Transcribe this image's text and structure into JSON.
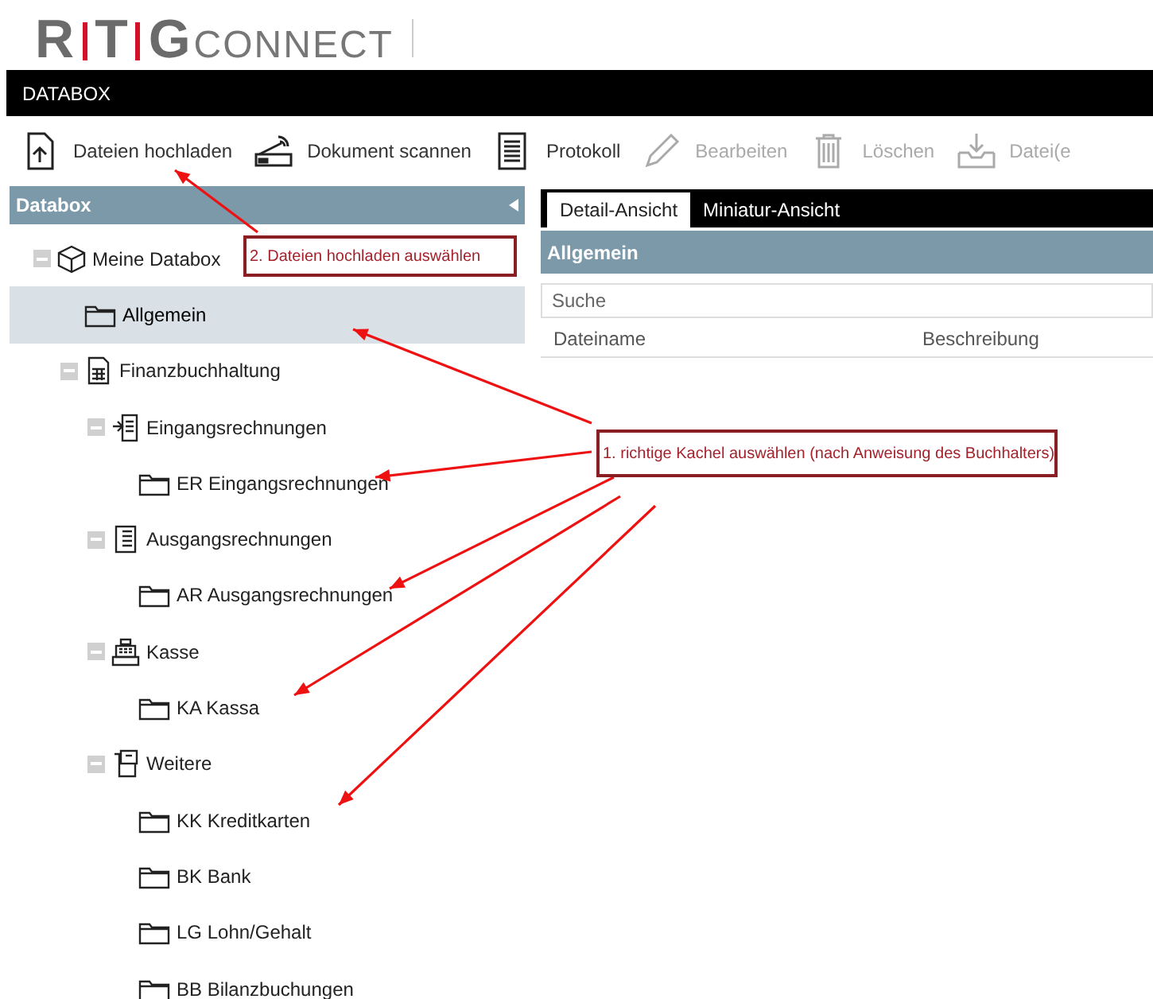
{
  "logo": {
    "letters": [
      "R",
      "T",
      "G"
    ],
    "suffix": "CONNECT"
  },
  "app_bar": {
    "title": "DATABOX"
  },
  "toolbar": [
    {
      "label": "Dateien hochladen",
      "kind": "upload",
      "disabled": false
    },
    {
      "label": "Dokument scannen",
      "kind": "scanner",
      "disabled": false
    },
    {
      "label": "Protokoll",
      "kind": "list",
      "disabled": false
    },
    {
      "label": "Bearbeiten",
      "kind": "pencil",
      "disabled": true
    },
    {
      "label": "Löschen",
      "kind": "trash",
      "disabled": true
    },
    {
      "label": "Datei(e",
      "kind": "download",
      "disabled": true
    }
  ],
  "sidebar": {
    "title": "Databox",
    "tree": [
      {
        "label": "Meine Databox",
        "kind": "cube",
        "expanded": true,
        "selected": false,
        "children": [
          {
            "label": "Allgemein",
            "kind": "folder",
            "selected": true
          },
          {
            "label": "Finanzbuchhaltung",
            "kind": "ledger",
            "expanded": true,
            "selected": false,
            "children": [
              {
                "label": "Eingangsrechnungen",
                "kind": "inbox",
                "expanded": true,
                "selected": false,
                "children": [
                  {
                    "label": "ER Eingangsrechnungen",
                    "kind": "folder",
                    "selected": false
                  }
                ]
              },
              {
                "label": "Ausgangsrechnungen",
                "kind": "document",
                "expanded": true,
                "selected": false,
                "children": [
                  {
                    "label": "AR Ausgangsrechnungen",
                    "kind": "folder",
                    "selected": false
                  }
                ]
              },
              {
                "label": "Kasse",
                "kind": "register",
                "expanded": true,
                "selected": false,
                "children": [
                  {
                    "label": "KA Kassa",
                    "kind": "folder",
                    "selected": false
                  }
                ]
              },
              {
                "label": "Weitere",
                "kind": "clipboard",
                "expanded": true,
                "selected": false,
                "children": [
                  {
                    "label": "KK Kreditkarten",
                    "kind": "folder",
                    "selected": false
                  },
                  {
                    "label": "BK Bank",
                    "kind": "folder",
                    "selected": false
                  },
                  {
                    "label": "LG Lohn/Gehalt",
                    "kind": "folder",
                    "selected": false
                  },
                  {
                    "label": "BB Bilanzbuchungen",
                    "kind": "folder",
                    "selected": false
                  }
                ]
              }
            ]
          }
        ]
      }
    ]
  },
  "view_tabs": [
    {
      "label": "Detail-Ansicht",
      "selected": true
    },
    {
      "label": "Miniatur-Ansicht",
      "selected": false
    }
  ],
  "panel": {
    "title": "Allgemein",
    "search": {
      "placeholder": "Suche"
    },
    "columns": [
      "Dateiname",
      "Beschreibung"
    ]
  },
  "annotations": [
    {
      "text": "2. Dateien hochladen auswählen"
    },
    {
      "text": "1. richtige Kachel auswählen (nach Anweisung des Buchhalters)"
    }
  ]
}
